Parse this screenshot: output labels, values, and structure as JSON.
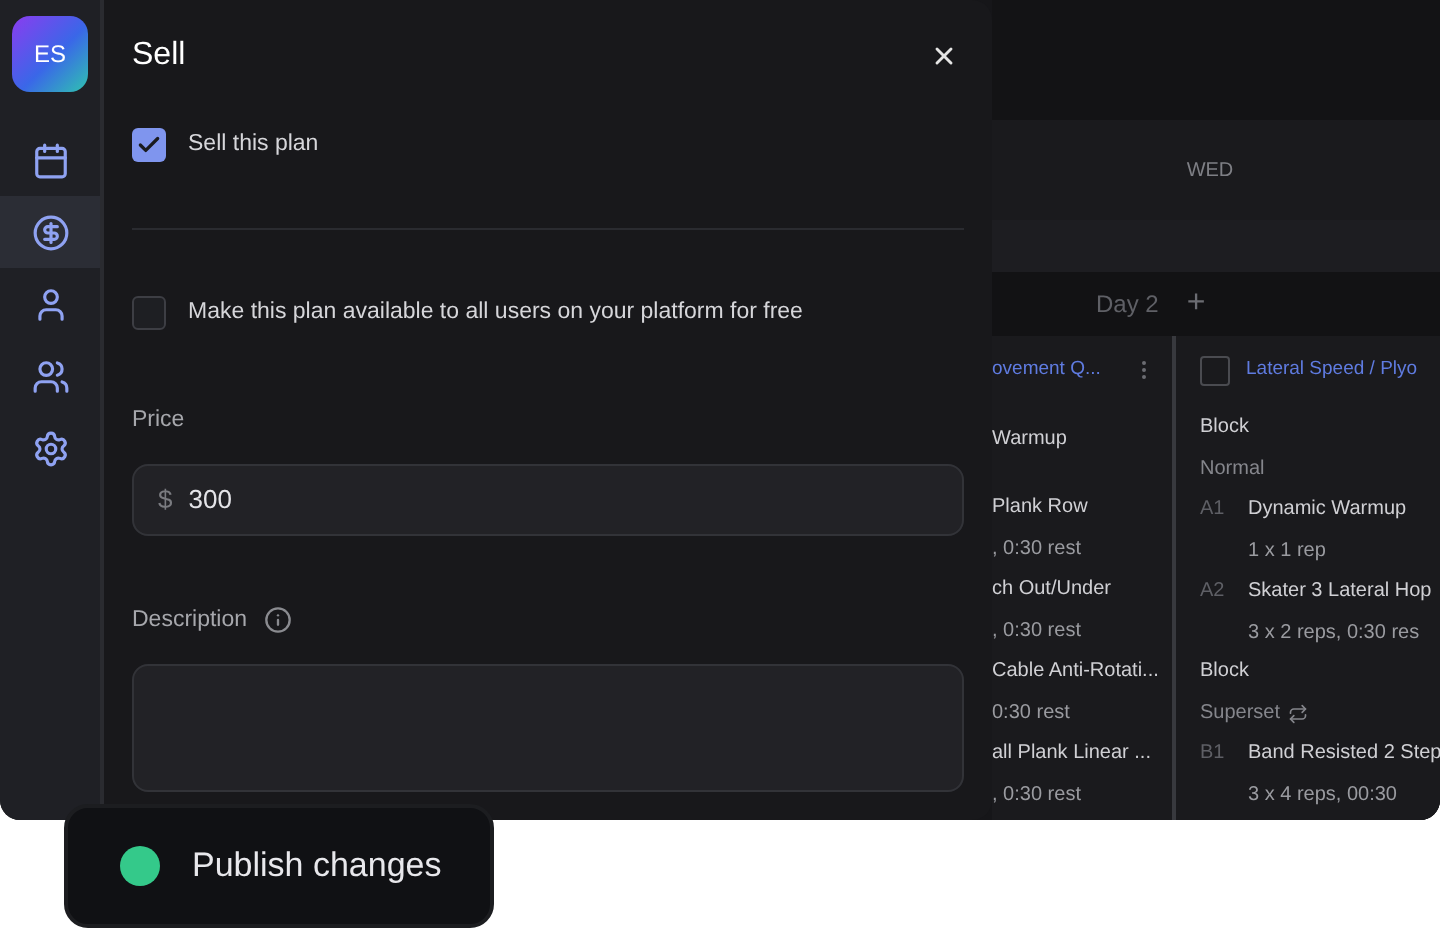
{
  "sidebar": {
    "avatar": "ES",
    "items": [
      {
        "selected": false
      },
      {
        "selected": true
      },
      {
        "selected": false
      },
      {
        "selected": false
      },
      {
        "selected": false
      }
    ]
  },
  "modal": {
    "title": "Sell",
    "checkboxes": [
      {
        "label": "Sell this plan",
        "checked": true
      },
      {
        "label": "Make this plan available to all users on your platform for free",
        "checked": false
      }
    ],
    "price": {
      "label": "Price",
      "currency": "$",
      "value": "300"
    },
    "description": {
      "label": "Description"
    }
  },
  "calendar": {
    "day_header": "WED",
    "day_label": "Day 2",
    "add": "+",
    "columns": [
      {
        "title": "ovement Q...",
        "items": [
          {
            "kind": "heading",
            "title": "Warmup"
          },
          {
            "kind": "exercise",
            "name": "Plank Row",
            "detail": ", 0:30 rest"
          },
          {
            "kind": "exercise",
            "name": "ch Out/Under",
            "detail": ", 0:30 rest"
          },
          {
            "kind": "exercise",
            "name": "Cable Anti-Rotati...",
            "detail": "0:30 rest"
          },
          {
            "kind": "exercise",
            "name": "all Plank Linear ...",
            "detail": ", 0:30 rest"
          }
        ]
      },
      {
        "title": "Lateral Speed / Plyo",
        "checked": false,
        "items": [
          {
            "kind": "block",
            "title": "Block",
            "subtitle": "Normal",
            "repeat": false
          },
          {
            "kind": "exercise",
            "code": "A1",
            "name": "Dynamic Warmup",
            "detail": "1 x 1 rep"
          },
          {
            "kind": "exercise",
            "code": "A2",
            "name": "Skater 3 Lateral Hop",
            "detail": "3 x 2 reps,  0:30 res"
          },
          {
            "kind": "block",
            "title": "Block",
            "subtitle": "Superset",
            "repeat": true
          },
          {
            "kind": "exercise",
            "code": "B1",
            "name": "Band Resisted 2 Step",
            "detail": "3 x 4 reps,  00:30"
          }
        ]
      }
    ]
  },
  "toast": {
    "label": "Publish changes"
  }
}
